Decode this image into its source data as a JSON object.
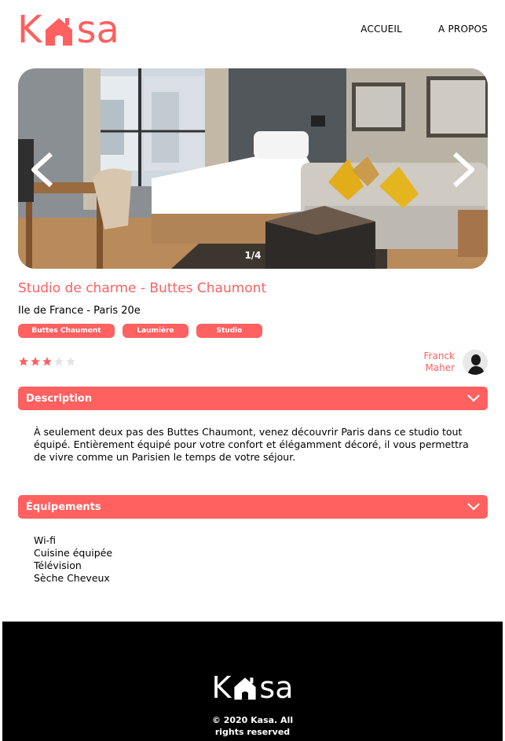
{
  "header": {
    "logo": "Kasa",
    "nav": [
      {
        "label": "ACCUEIL"
      },
      {
        "label": "A PROPOS"
      }
    ]
  },
  "carousel": {
    "counter": "1/4"
  },
  "listing": {
    "title": "Studio de charme - Buttes Chaumont",
    "location": "Ile de France - Paris 20e",
    "tags": [
      "Buttes Chaumont",
      "Laumière",
      "Studio"
    ],
    "rating": 3,
    "rating_max": 5,
    "host_first": "Franck",
    "host_last": "Maher"
  },
  "description": {
    "title": "Description",
    "text": "À seulement deux pas des Buttes Chaumont, venez découvrir Paris dans ce studio tout équipé. Entièrement équipé pour votre confort et élégamment décoré, il vous permettra de vivre comme un Parisien le temps de votre séjour."
  },
  "equipments": {
    "title": "Équipements",
    "items": [
      "Wi-fi",
      "Cuisine équipée",
      "Télévision",
      "Sèche Cheveux"
    ]
  },
  "footer": {
    "logo": "Kasa",
    "copyright_line1": "© 2020 Kasa. All",
    "copyright_line2": "rights reserved"
  },
  "colors": {
    "accent": "#FF6060",
    "footer_bg": "#000000",
    "star_empty": "#E3E3E3"
  }
}
